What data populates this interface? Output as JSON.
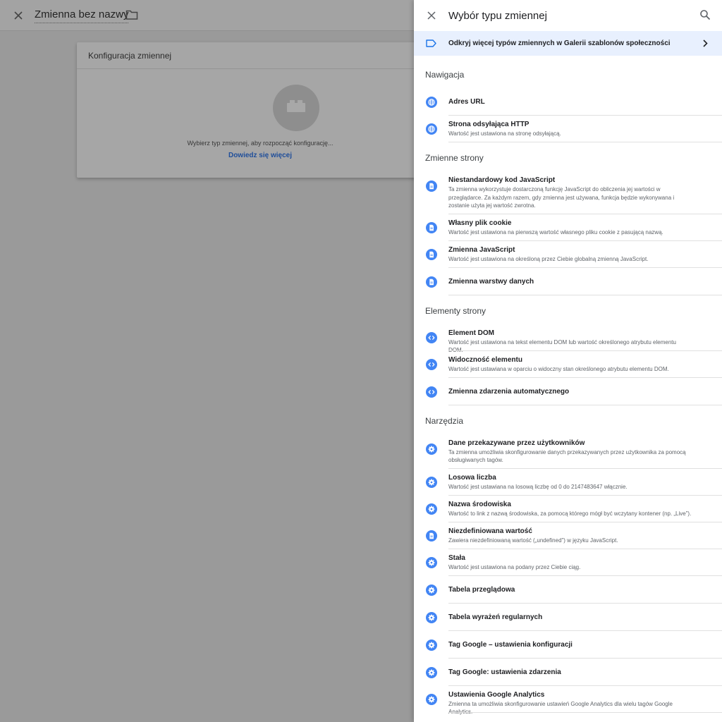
{
  "editor": {
    "title": "Zmienna bez nazwy",
    "card_title": "Konfiguracja zmiennej",
    "card_hint": "Wybierz typ zmiennej, aby rozpocząć konfigurację...",
    "card_link": "Dowiedz się więcej"
  },
  "panel": {
    "title": "Wybór typu zmiennej",
    "banner": "Odkryj więcej typów zmiennych w Galerii szablonów społeczności",
    "sections": [
      {
        "title": "Nawigacja",
        "items": [
          {
            "icon": "globe-icon",
            "title": "Adres URL",
            "desc": ""
          },
          {
            "icon": "globe-icon",
            "title": "Strona odsyłająca HTTP",
            "desc": "Wartość jest ustawiona na stronę odsyłającą."
          }
        ]
      },
      {
        "title": "Zmienne strony",
        "items": [
          {
            "icon": "document-icon",
            "title": "Niestandardowy kod JavaScript",
            "desc": "Ta zmienna wykorzystuje dostarczoną funkcję JavaScript do obliczenia jej wartości w przeglądarce. Za każdym razem, gdy zmienna jest używana, funkcja będzie wykonywana i zostanie użyta jej wartość zwrotna."
          },
          {
            "icon": "document-icon",
            "title": "Własny plik cookie",
            "desc": "Wartość jest ustawiona na pierwszą wartość własnego pliku cookie z pasującą nazwą."
          },
          {
            "icon": "document-icon",
            "title": "Zmienna JavaScript",
            "desc": "Wartość jest ustawiona na określoną przez Ciebie globalną zmienną JavaScript."
          },
          {
            "icon": "document-icon",
            "title": "Zmienna warstwy danych",
            "desc": ""
          }
        ]
      },
      {
        "title": "Elementy strony",
        "items": [
          {
            "icon": "code-icon",
            "title": "Element DOM",
            "desc": "Wartość jest ustawiona na tekst elementu DOM lub wartość określonego atrybutu elementu DOM."
          },
          {
            "icon": "code-icon",
            "title": "Widoczność elementu",
            "desc": "Wartość jest ustawiana w oparciu o widoczny stan określonego atrybutu elementu DOM."
          },
          {
            "icon": "code-icon",
            "title": "Zmienna zdarzenia automatycznego",
            "desc": ""
          }
        ]
      },
      {
        "title": "Narzędzia",
        "items": [
          {
            "icon": "gear-icon",
            "title": "Dane przekazywane przez użytkowników",
            "desc": "Ta zmienna umożliwia skonfigurowanie danych przekazywanych przez użytkownika za pomocą obsługiwanych tagów."
          },
          {
            "icon": "gear-icon",
            "title": "Losowa liczba",
            "desc": "Wartość jest ustawiana na losową liczbę od 0 do 2147483647 włącznie."
          },
          {
            "icon": "gear-icon",
            "title": "Nazwa środowiska",
            "desc": "Wartość to link z nazwą środowiska, za pomocą którego mógł być wczytany kontener (np. „Live”)."
          },
          {
            "icon": "document-icon",
            "title": "Niezdefiniowana wartość",
            "desc": "Zawiera niezdefiniowaną wartość („undefined”) w języku JavaScript."
          },
          {
            "icon": "gear-icon",
            "title": "Stała",
            "desc": "Wartość jest ustawiona na podany przez Ciebie ciąg."
          },
          {
            "icon": "gear-icon",
            "title": "Tabela przeglądowa",
            "desc": ""
          },
          {
            "icon": "gear-icon",
            "title": "Tabela wyrażeń regularnych",
            "desc": ""
          },
          {
            "icon": "gear-icon",
            "title": "Tag Google – ustawienia konfiguracji",
            "desc": ""
          },
          {
            "icon": "gear-icon",
            "title": "Tag Google: ustawienia zdarzenia",
            "desc": ""
          },
          {
            "icon": "gear-icon",
            "title": "Ustawienia Google Analytics",
            "desc": "Zmienna ta umożliwia skonfigurowanie ustawień Google Analytics dla wielu tagów Google Analytics."
          }
        ]
      }
    ]
  },
  "colors": {
    "accent": "#4285f4",
    "banner_bg": "#e8f0fe",
    "link": "#1f4e9a",
    "overlay_bg": "#9a9a9a"
  }
}
